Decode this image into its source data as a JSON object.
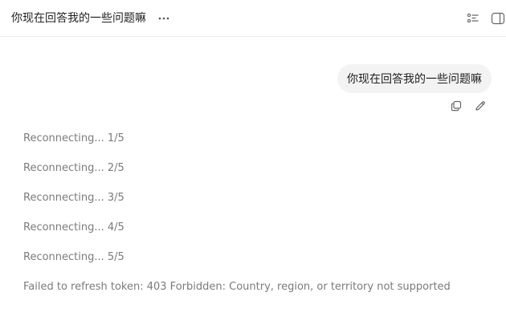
{
  "header": {
    "title": "你现在回答我的一些问题嘛",
    "more_icon": "ellipsis-icon",
    "right_icons": [
      "list-icon",
      "sidebar-toggle-icon"
    ]
  },
  "conversation": {
    "user_message": "你现在回答我的一些问题嘛",
    "message_actions": [
      "copy-icon",
      "edit-icon"
    ],
    "status_lines": [
      "Reconnecting... 1/5",
      "Reconnecting... 2/5",
      "Reconnecting... 3/5",
      "Reconnecting... 4/5",
      "Reconnecting... 5/5"
    ],
    "error": "Failed to refresh token: 403 Forbidden: Country, region, or territory not supported"
  },
  "colors": {
    "status_text": "#7b7b7b",
    "bubble_background": "#f3f3f3",
    "icon": "#666666"
  }
}
